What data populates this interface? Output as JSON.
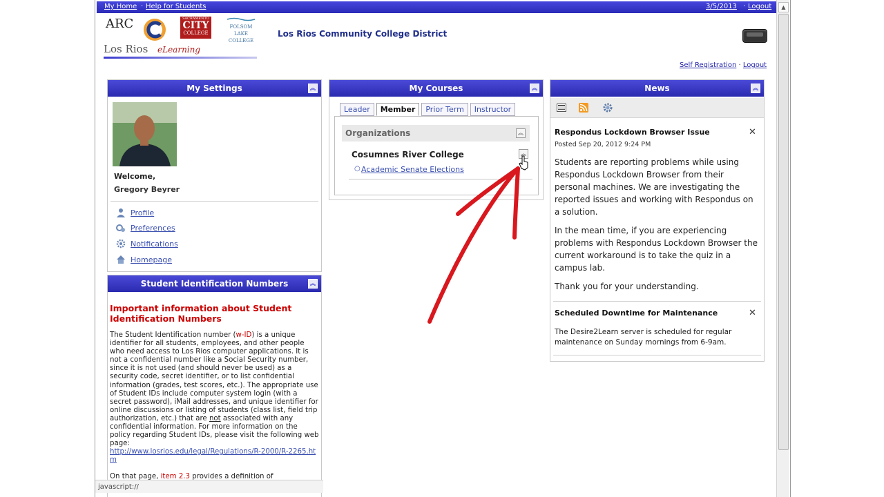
{
  "topbar": {
    "my_home": "My Home",
    "sep": "·",
    "help": "Help for Students",
    "date": "3/5/2013",
    "logout": "Logout"
  },
  "header": {
    "logos": {
      "arc": "ARC",
      "city_top": "SACRAMENTO",
      "city": "CITY",
      "city_bottom": "COLLEGE",
      "folsom": [
        "FOLSOM",
        "LAKE",
        "COLLEGE"
      ],
      "brand": "Los Rios",
      "brand_sub": "eLearning"
    },
    "district": "Los Rios Community College District",
    "self_registration": "Self Registration",
    "logout": "Logout"
  },
  "settings": {
    "title": "My Settings",
    "welcome": "Welcome,",
    "user_name": "Gregory Beyrer",
    "links": [
      {
        "label": "Profile",
        "icon": "person-icon"
      },
      {
        "label": "Preferences",
        "icon": "preferences-icon"
      },
      {
        "label": "Notifications",
        "icon": "notifications-icon"
      },
      {
        "label": "Homepage",
        "icon": "home-icon"
      }
    ]
  },
  "sid": {
    "title": "Student Identification Numbers",
    "heading": "Important information about Student Identification Numbers",
    "p1_a": "The Student Identification number (",
    "p1_wid": "w-ID",
    "p1_b": ") is a unique identifier for all students, employees, and other people who need access to Los Rios computer applications. It is not a confidential number like a Social Security number, since it is not used (and should never be used) as a security code, secret identifier, or to list confidential information (grades, test scores, etc.). The appropriate use of Student IDs include computer system login (with a secret password), iMail addresses, and unique identifier for online discussions or listing of students (class list, field trip authorization, etc.) that are ",
    "p1_not": "not",
    "p1_c": " associated with any confidential information. For more information on the policy regarding Student IDs, please visit the following web page:",
    "p1_link": "http://www.losrios.edu/legal/Regulations/R-2000/R-2265.htm",
    "p2_a": "On that page, ",
    "p2_item": "item 2.3",
    "p2_b": " provides a definition of"
  },
  "courses": {
    "title": "My Courses",
    "tabs": [
      "Leader",
      "Member",
      "Prior Term",
      "Instructor"
    ],
    "active_tab": "Member",
    "section": "Organizations",
    "org": "Cosumnes River College",
    "items": [
      "Academic Senate Elections"
    ]
  },
  "news": {
    "title": "News",
    "items": [
      {
        "title": "Respondus Lockdown Browser Issue",
        "posted": "Posted Sep 20, 2012 9:24 PM",
        "paras": [
          "Students are reporting problems while using Respondus Lockdown Browser from their personal machines. We are investigating the reported issues and working with Respondus on a solution.",
          "In the mean time, if you are experiencing problems with Respondus Lockdown Browser the current workaround is to take the quiz in a campus lab.",
          "Thank you for your understanding."
        ]
      },
      {
        "title": "Scheduled Downtime for Maintenance",
        "paras": [
          "The Desire2Learn server is scheduled for regular maintenance on Sunday mornings from 6-9am."
        ]
      }
    ]
  },
  "status": {
    "text": "javascript://"
  },
  "colors": {
    "header_blue": "#3b3bd0",
    "accent_red": "#cc0000",
    "arrow_red": "#d8181e",
    "link": "#3a4fb0"
  }
}
